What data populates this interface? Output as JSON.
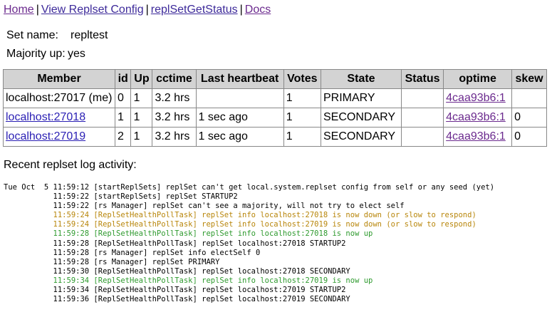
{
  "nav": {
    "links": [
      "Home",
      "View Replset Config",
      "replSetGetStatus",
      "Docs"
    ],
    "separator": "|"
  },
  "set_name": {
    "label": "Set name:",
    "value": "repltest"
  },
  "majority_up": {
    "label": "Majority up:",
    "value": "yes"
  },
  "table": {
    "headers": [
      "Member",
      "id",
      "Up",
      "cctime",
      "Last heartbeat",
      "Votes",
      "State",
      "Status",
      "optime",
      "skew"
    ],
    "rows": [
      {
        "member": "localhost:27017 (me)",
        "id": "0",
        "up": "1",
        "cctime": "3.2 hrs",
        "last_heartbeat": "",
        "votes": "1",
        "state": "PRIMARY",
        "status": "",
        "optime": "4caa93b6:1",
        "skew": ""
      },
      {
        "member": "localhost:27018",
        "id": "1",
        "up": "1",
        "cctime": "3.2 hrs",
        "last_heartbeat": "1 sec ago",
        "votes": "1",
        "state": "SECONDARY",
        "status": "",
        "optime": "4caa93b6:1",
        "skew": "0"
      },
      {
        "member": "localhost:27019",
        "id": "2",
        "up": "1",
        "cctime": "3.2 hrs",
        "last_heartbeat": "1 sec ago",
        "votes": "1",
        "state": "SECONDARY",
        "status": "",
        "optime": "4caa93b6:1",
        "skew": "0"
      }
    ]
  },
  "recent_label": "Recent replset log activity:",
  "log": [
    {
      "text": "Tue Oct  5 11:59:12 [startReplSets] replSet can't get local.system.replset config from self or any seed (yet)",
      "level": "normal"
    },
    {
      "text": "           11:59:22 [startReplSets] replSet STARTUP2",
      "level": "normal"
    },
    {
      "text": "           11:59:22 [rs Manager] replSet can't see a majority, will not try to elect self",
      "level": "normal"
    },
    {
      "text": "           11:59:24 [ReplSetHealthPollTask] replSet info localhost:27018 is now down (or slow to respond)",
      "level": "warn"
    },
    {
      "text": "           11:59:24 [ReplSetHealthPollTask] replSet info localhost:27019 is now down (or slow to respond)",
      "level": "warn"
    },
    {
      "text": "           11:59:28 [ReplSetHealthPollTask] replSet info localhost:27018 is now up",
      "level": "up"
    },
    {
      "text": "           11:59:28 [ReplSetHealthPollTask] replSet localhost:27018 STARTUP2",
      "level": "normal"
    },
    {
      "text": "           11:59:28 [rs Manager] replSet info electSelf 0",
      "level": "normal"
    },
    {
      "text": "           11:59:28 [rs Manager] replSet PRIMARY",
      "level": "normal"
    },
    {
      "text": "           11:59:30 [ReplSetHealthPollTask] replSet localhost:27018 SECONDARY",
      "level": "normal"
    },
    {
      "text": "           11:59:34 [ReplSetHealthPollTask] replSet info localhost:27019 is now up",
      "level": "up"
    },
    {
      "text": "           11:59:34 [ReplSetHealthPollTask] replSet localhost:27019 STARTUP2",
      "level": "normal"
    },
    {
      "text": "           11:59:36 [ReplSetHealthPollTask] replSet localhost:27019 SECONDARY",
      "level": "normal"
    }
  ],
  "colors": {
    "warn": "#b8860b",
    "up": "#2e9a2e",
    "link": "#2a1fb4",
    "visited_link": "#6b2a8e",
    "header_bg": "#d3d3d3"
  }
}
